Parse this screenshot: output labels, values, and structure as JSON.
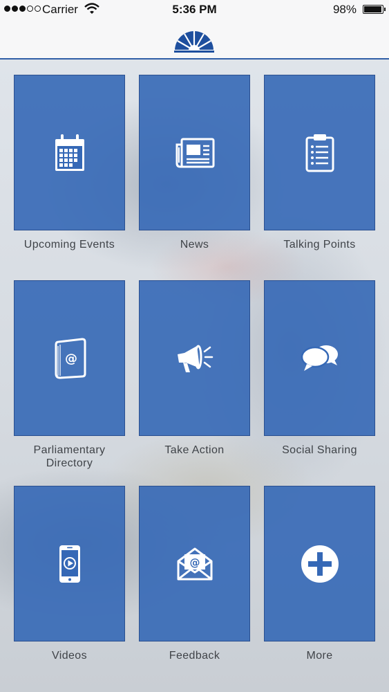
{
  "status_bar": {
    "carrier": "Carrier",
    "time": "5:36 PM",
    "battery_percent": "98%",
    "battery_level": 0.98,
    "signal_bars_filled": 3,
    "signal_bars_total": 5
  },
  "navbar": {
    "logo_icon": "semicircle-fan-logo"
  },
  "colors": {
    "tile": "#3568b6",
    "tile_border": "#2a4f8f",
    "label_text": "#3f4348",
    "accent": "#2f5ea7"
  },
  "menu": {
    "items": [
      {
        "label": "Upcoming Events",
        "icon": "calendar-icon"
      },
      {
        "label": "News",
        "icon": "newspaper-icon"
      },
      {
        "label": "Talking Points",
        "icon": "clipboard-list-icon"
      },
      {
        "label": "Parliamentary Directory",
        "icon": "address-book-icon"
      },
      {
        "label": "Take Action",
        "icon": "megaphone-icon"
      },
      {
        "label": "Social Sharing",
        "icon": "chat-bubbles-icon"
      },
      {
        "label": "Videos",
        "icon": "phone-video-icon"
      },
      {
        "label": "Feedback",
        "icon": "email-envelope-icon"
      },
      {
        "label": "More",
        "icon": "plus-circle-icon"
      }
    ]
  }
}
